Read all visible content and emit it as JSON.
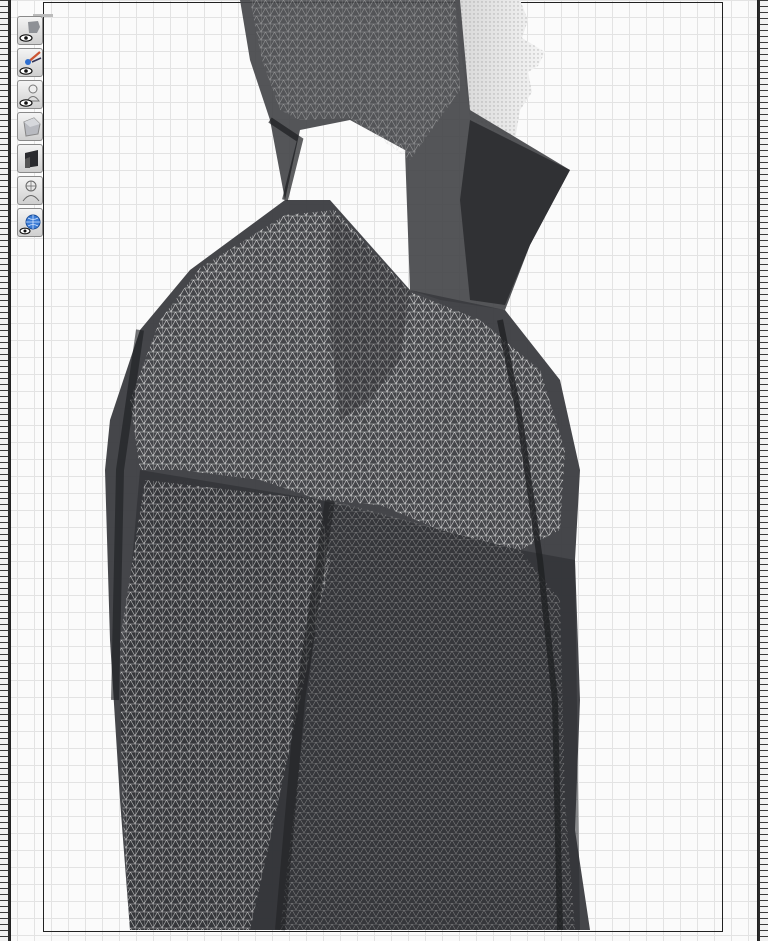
{
  "viewport": {
    "grid_color": "#e3e3e3",
    "background": "#fbfbfb",
    "mesh_line_color": "#d9d9d9",
    "garment_color": "#3b3c40",
    "skin_color": "#cfcfcf"
  },
  "toolbar": {
    "tools": [
      {
        "name": "show-garment-mesh",
        "icon": "eye-garment-icon"
      },
      {
        "name": "paint-tool",
        "icon": "eye-paint-icon"
      },
      {
        "name": "show-avatar",
        "icon": "eye-avatar-icon"
      },
      {
        "name": "surface-shade",
        "icon": "surface-icon"
      },
      {
        "name": "fabric-view",
        "icon": "fabric-icon"
      },
      {
        "name": "avatar-wireframe",
        "icon": "avatar-wire-icon"
      },
      {
        "name": "texture-globe",
        "icon": "eye-globe-icon"
      }
    ]
  }
}
